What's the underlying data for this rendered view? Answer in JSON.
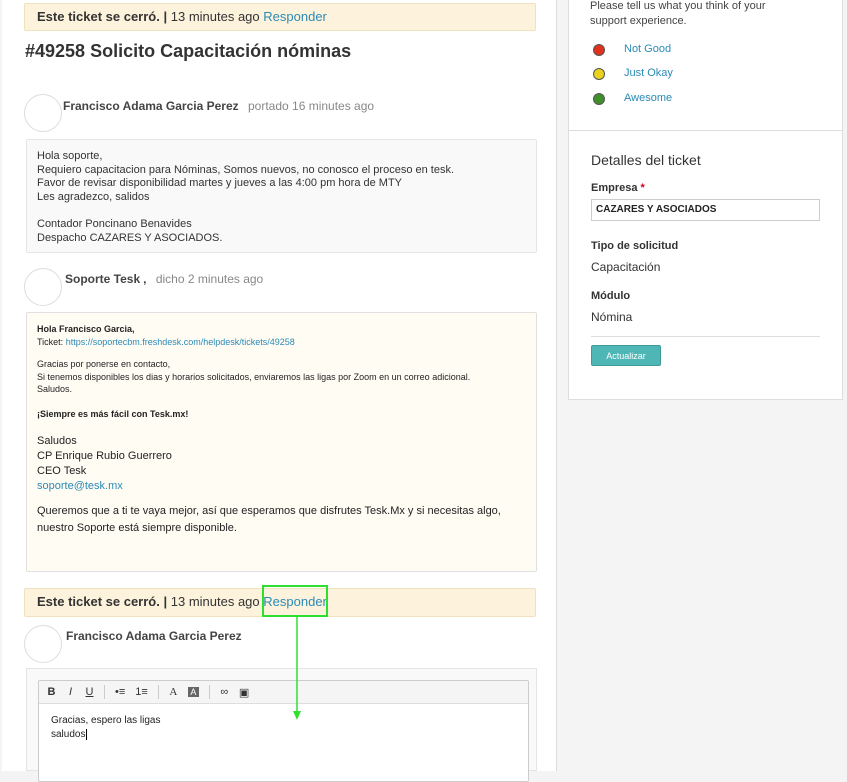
{
  "banner_top": {
    "closed_text": "Este ticket se cerró.",
    "sep": "|",
    "time": "13 minutes ago",
    "link": "Responder"
  },
  "ticket": {
    "title": "#49258 Solicito Capacitación nóminas"
  },
  "messages": [
    {
      "author": "Francisco Adama Garcia Perez",
      "meta": "portado 16 minutes ago",
      "lines": [
        "Hola soporte,",
        "Requiero capacitacion para Nóminas, Somos nuevos, no conosco el proceso en tesk.",
        "Favor de revisar disponibilidad martes y jueves a las 4:00 pm hora de MTY",
        "Les agradezco, salidos",
        "",
        "Contador Poncinano Benavides",
        "Despacho CAZARES Y ASOCIADOS."
      ]
    },
    {
      "author": "Soporte Tesk",
      "author_suffix": ",",
      "meta": "dicho 2 minutes ago"
    }
  ],
  "reply": {
    "greeting": "Hola Francisco Garcia,",
    "ticket_label": "Ticket:",
    "ticket_url": "https://soportecbm.freshdesk.com/helpdesk/tickets/49258",
    "line1": "Gracias por ponerse en contacto,",
    "line2": "Si tenemos disponibles los dias y horarios solicitados, enviaremos las ligas por Zoom en un correo adicional.",
    "line3": "Saludos.",
    "slogan": "¡Siempre es más fácil con Tesk.mx!",
    "sig1": "Saludos",
    "sig2": "CP Enrique Rubio Guerrero",
    "sig3": "CEO Tesk",
    "email": "soporte@tesk.mx",
    "closing": "Queremos que a ti te vaya mejor, así que esperamos que disfrutes Tesk.Mx y si necesitas algo, nuestro Soporte está siempre disponible."
  },
  "banner_bottom": {
    "closed_text": "Este ticket se cerró.",
    "sep": "|",
    "time": "13 minutes ago",
    "link": "Responder"
  },
  "composer": {
    "author": "Francisco Adama Garcia Perez",
    "text_line1": "Gracias, espero las ligas",
    "text_line2": "saludos",
    "toolbar": [
      "B",
      "I",
      "U",
      "•≡",
      "1≡",
      "A",
      "A",
      "∞",
      "▣"
    ]
  },
  "feedback": {
    "intro_line1": "Please tell us what you think of your",
    "intro_line2": "support experience.",
    "options": [
      {
        "label": "Not Good",
        "color": "#e0301e"
      },
      {
        "label": "Just Okay",
        "color": "#e8d21d"
      },
      {
        "label": "Awesome",
        "color": "#3f8f2a"
      }
    ]
  },
  "details": {
    "title": "Detalles del ticket",
    "empresa_label": "Empresa",
    "required_mark": "*",
    "empresa_value": "CAZARES Y ASOCIADOS",
    "tipo_label": "Tipo de solicitud",
    "tipo_value": "Capacitación",
    "modulo_label": "Módulo",
    "modulo_value": "Nómina",
    "update_button": "Actualizar"
  }
}
